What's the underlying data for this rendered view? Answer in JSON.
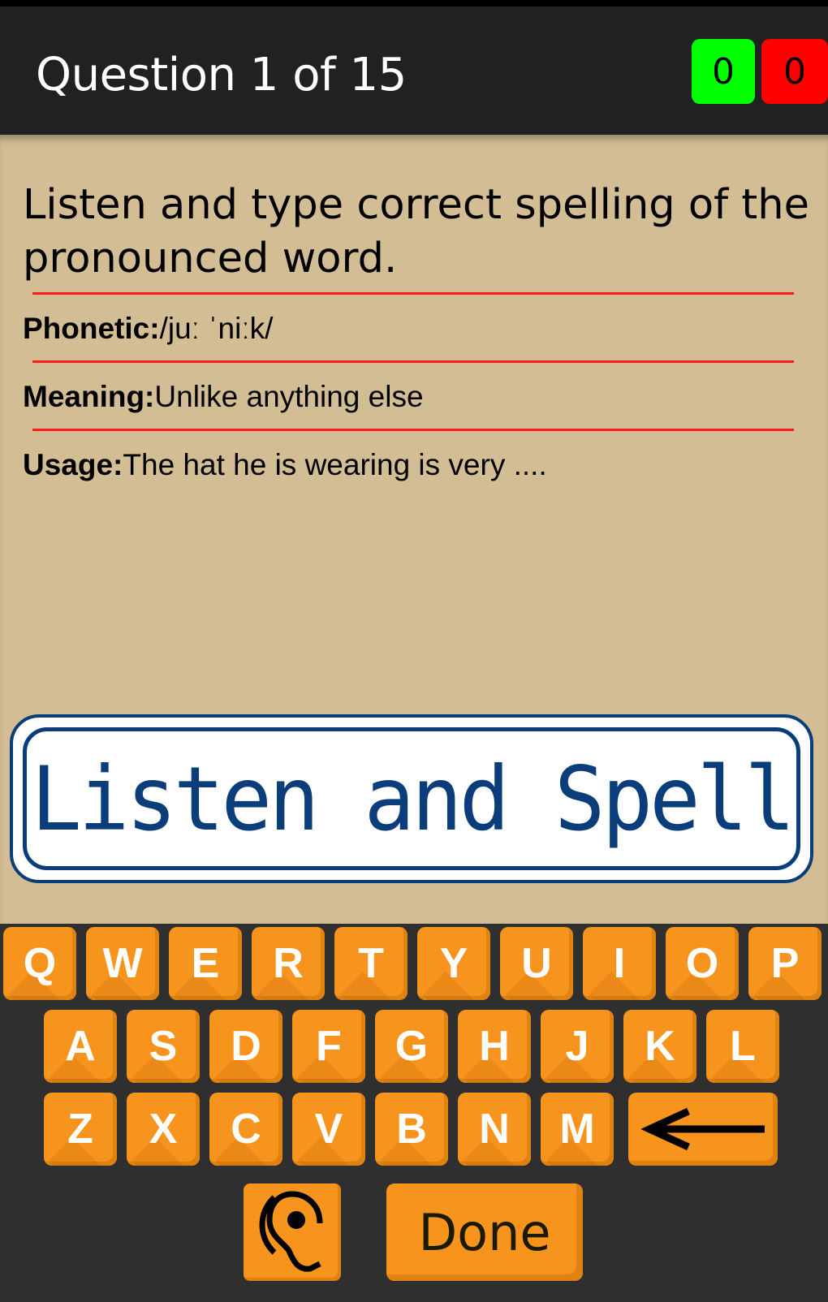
{
  "header": {
    "title": "Question 1 of 15",
    "correct_count": "0",
    "wrong_count": "0",
    "colors": {
      "correct": "#00ff00",
      "wrong": "#ff0000"
    }
  },
  "question": {
    "instruction": "Listen and type correct spelling of the pronounced word.",
    "phonetic_label": "Phonetic:",
    "phonetic_value": "/juː ˈniːk/",
    "meaning_label": "Meaning:",
    "meaning_value": "Unlike anything else",
    "usage_label": "Usage:",
    "usage_value": "The hat he is wearing is very ...."
  },
  "banner": {
    "text": "Listen and Spell",
    "color": "#0a3d7a"
  },
  "keyboard": {
    "rows": [
      [
        "Q",
        "W",
        "E",
        "R",
        "T",
        "Y",
        "U",
        "I",
        "O",
        "P"
      ],
      [
        "A",
        "S",
        "D",
        "F",
        "G",
        "H",
        "J",
        "K",
        "L"
      ],
      [
        "Z",
        "X",
        "C",
        "V",
        "B",
        "N",
        "M"
      ]
    ],
    "backspace_icon": "left-arrow-icon",
    "listen_icon": "ear-icon",
    "done_label": "Done",
    "key_color": "#f7941d"
  }
}
